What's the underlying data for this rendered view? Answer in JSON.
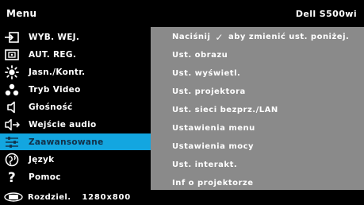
{
  "header": {
    "title": "Menu",
    "model": "Dell S500wi"
  },
  "menu": {
    "items": [
      {
        "label": "WYB. WEJ.",
        "icon": "input-source-icon"
      },
      {
        "label": "AUT. REG.",
        "icon": "auto-adjust-icon"
      },
      {
        "label": "Jasn./Kontr.",
        "icon": "brightness-icon"
      },
      {
        "label": "Tryb Video",
        "icon": "video-mode-icon"
      },
      {
        "label": "Głośność",
        "icon": "speaker-icon"
      },
      {
        "label": "Wejście audio",
        "icon": "audio-input-icon"
      },
      {
        "label": "Zaawansowane",
        "icon": "advanced-settings-icon",
        "selected": true
      },
      {
        "label": "Język",
        "icon": "language-globe-icon"
      },
      {
        "label": "Pomoc",
        "icon": "help-question-icon"
      }
    ]
  },
  "submenu": {
    "hint_prefix": "Naciśnij",
    "hint_suffix": "aby zmienić ust. poniżej.",
    "items": [
      "Ust. obrazu",
      "Ust. wyświetl.",
      "Ust. projektora",
      "Ust. sieci bezprz./LAN",
      "Ustawienia menu",
      "Ustawienia mocy",
      "Ust. interakt.",
      "Inf o projektorze"
    ]
  },
  "footer": {
    "resolution_label": "Rozdziel.",
    "resolution_value": "1280x800",
    "icon": "display-resolution-icon"
  },
  "colors": {
    "background": "#000000",
    "panel": "#8a8a8a",
    "highlight": "#13a6e0"
  }
}
